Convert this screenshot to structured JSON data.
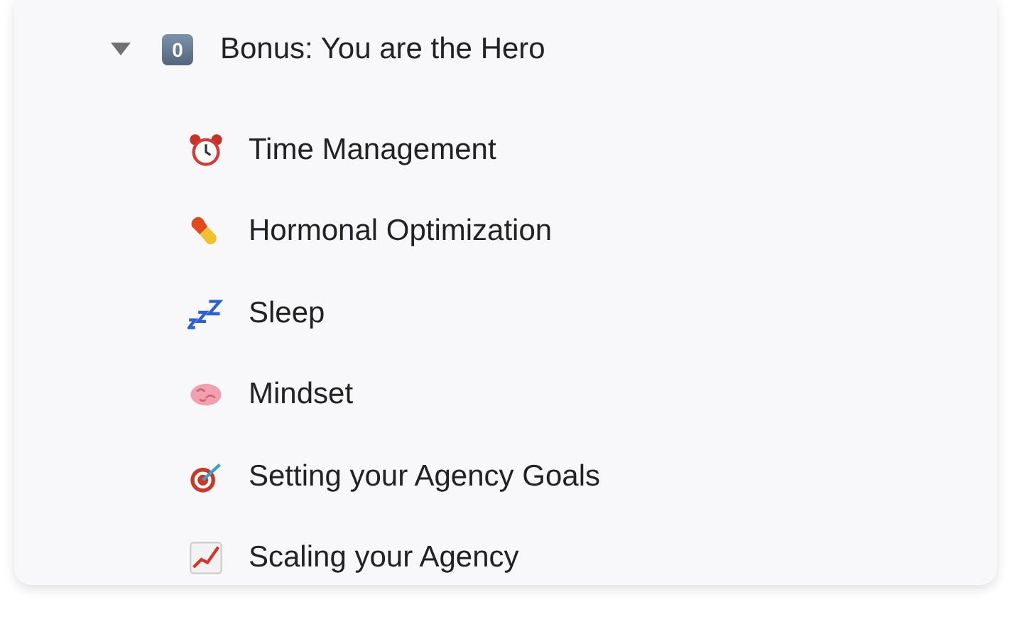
{
  "section": {
    "title": "Bonus: You are the Hero",
    "badge": "0",
    "expanded": true,
    "children": [
      {
        "label": "Time Management",
        "kind": "clock"
      },
      {
        "label": "Hormonal Optimization",
        "kind": "pill"
      },
      {
        "label": "Sleep",
        "kind": "zzz"
      },
      {
        "label": "Mindset",
        "kind": "brain"
      },
      {
        "label": "Setting your Agency Goals",
        "kind": "target"
      },
      {
        "label": "Scaling your Agency",
        "kind": "chart"
      }
    ]
  }
}
